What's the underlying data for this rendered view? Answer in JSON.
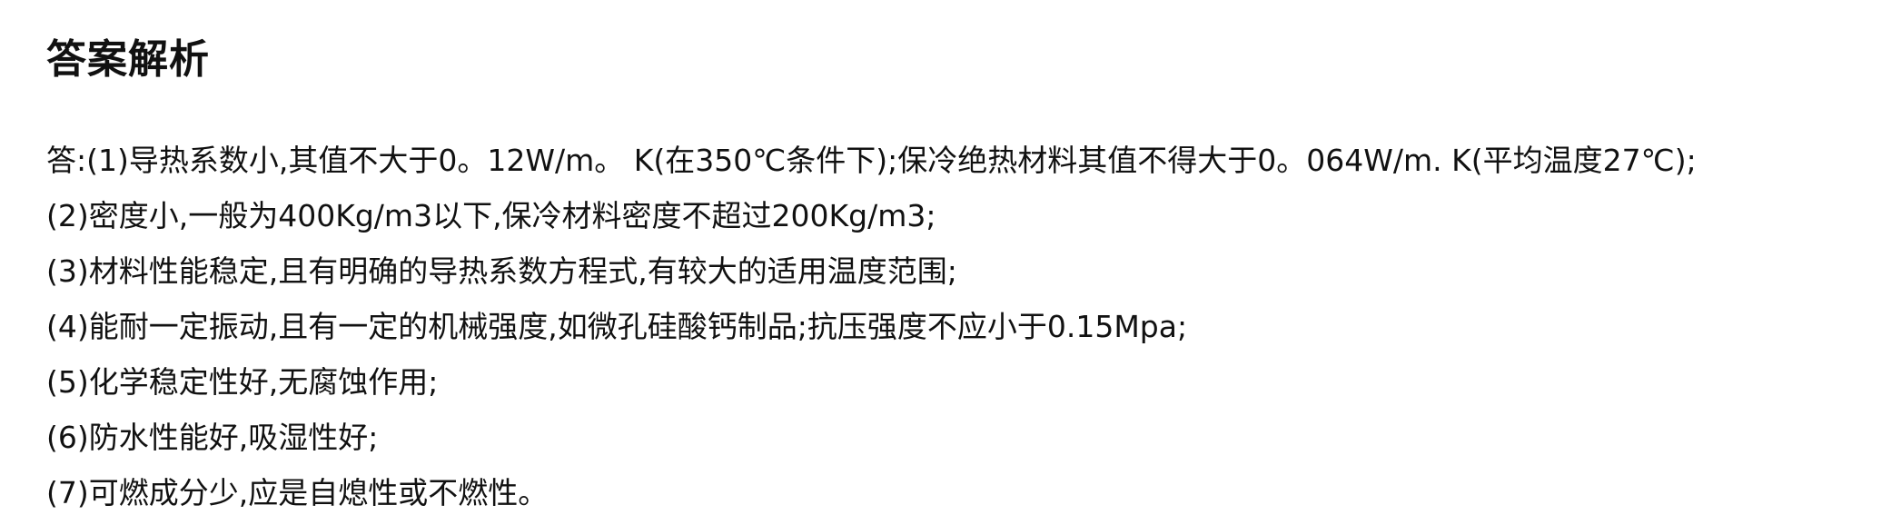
{
  "heading": "答案解析",
  "answer_lines": [
    "答:(1)导热系数小,其值不大于0。12W/m。 K(在350℃条件下);保冷绝热材料其值不得大于0。064W/m. K(平均温度27℃);",
    "(2)密度小,一般为400Kg/m3以下,保冷材料密度不超过200Kg/m3;",
    "(3)材料性能稳定,且有明确的导热系数方程式,有较大的适用温度范围;",
    "(4)能耐一定振动,且有一定的机械强度,如微孔硅酸钙制品;抗压强度不应小于0.15Mpa;",
    "(5)化学稳定性好,无腐蚀作用;",
    "(6)防水性能好,吸湿性好;",
    "(7)可燃成分少,应是自熄性或不燃性。"
  ]
}
